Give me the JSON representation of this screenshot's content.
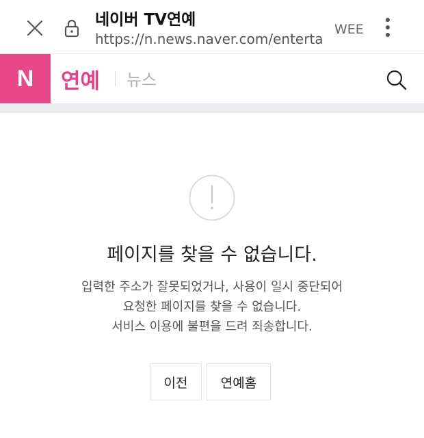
{
  "browser": {
    "title": "네이버 TV연예",
    "url": "https://n.news.naver.com/entertain",
    "extra_text": "WEE",
    "icons": {
      "close": "close-icon",
      "lock": "lock-icon",
      "menu": "more-vertical-icon"
    }
  },
  "header": {
    "logo": "N",
    "section": "연예",
    "sub_section": "뉴스",
    "brand_color": "#e8488a",
    "search_icon": "search-icon"
  },
  "error": {
    "icon": "exclamation-circle-icon",
    "title": "페이지를 찾을 수 없습니다.",
    "message_lines": [
      "입력한 주소가 잘못되었거나, 사용이 일시 중단되어",
      "요청한 페이지를 찾을 수 없습니다.",
      "서비스 이용에 불편을 드려 죄송합니다."
    ]
  },
  "buttons": {
    "prev": "이전",
    "home": "연예홈"
  }
}
